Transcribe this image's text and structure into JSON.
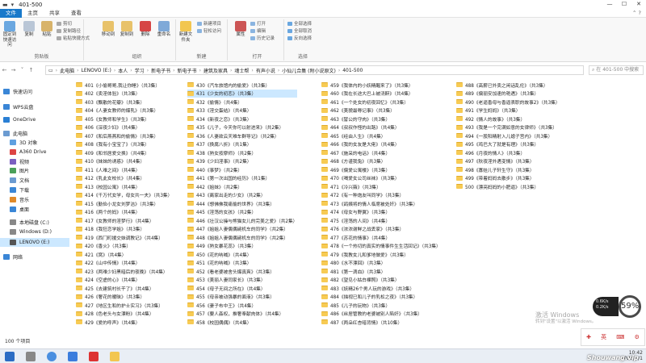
{
  "window": {
    "title": "401-500"
  },
  "ribbon_tabs": [
    "文件",
    "主页",
    "共享",
    "查看"
  ],
  "ribbon": {
    "groups": [
      {
        "label": "剪贴板",
        "big": [
          "固定到快速访问",
          "复制",
          "粘贴"
        ],
        "small": [
          "剪切",
          "复制路径",
          "粘贴快捷方式"
        ]
      },
      {
        "label": "组织",
        "big": [
          "移动到",
          "复制到",
          "删除",
          "重命名"
        ],
        "small": []
      },
      {
        "label": "新建",
        "big": [
          "新建文件夹"
        ],
        "small": [
          "新建项目",
          "轻松访问"
        ]
      },
      {
        "label": "打开",
        "big": [
          "属性"
        ],
        "small": [
          "打开",
          "编辑",
          "历史记录"
        ]
      },
      {
        "label": "选择",
        "big": [],
        "small": [
          "全部选择",
          "全部取消",
          "反向选择"
        ]
      }
    ]
  },
  "address": {
    "path": [
      "此电脑",
      "LENOVO (E:)",
      "本人",
      "学习",
      "新电子书",
      "新电子书",
      "建筑及家具",
      "魂士帮",
      "有声小说",
      "小仙儿合集 (附小说原文)",
      "401-500"
    ],
    "search_placeholder": "在 401-500 中搜索"
  },
  "nav": [
    {
      "label": "快速访问"
    },
    {
      "label": "WPS云盘"
    },
    {
      "label": "OneDrive"
    },
    {
      "label": "此电脑"
    },
    {
      "label": "3D 对象"
    },
    {
      "label": "A360 Drive"
    },
    {
      "label": "视频"
    },
    {
      "label": "图片"
    },
    {
      "label": "文档"
    },
    {
      "label": "下载"
    },
    {
      "label": "音乐"
    },
    {
      "label": "桌面"
    },
    {
      "label": "本地磁盘 (C:)"
    },
    {
      "label": "Windows (D:)"
    },
    {
      "label": "LENOVO (E:)"
    },
    {
      "label": "网络"
    }
  ],
  "files": [
    [
      "401《小偷哥哥,我让你睡》（共3集）",
      "402《卖淫体验》（共3集）",
      "403《飘散的花瓣》（共3集）",
      "404《人妻女教师的爆乳》（共3集）",
      "405《女教师和学生》（共3集）",
      "406《深夜少妇》（共4集）",
      "407《和后燕燕和的偷情》（共3集）",
      "408《我有小宝宝了》（共3集）",
      "409《和邻居爱交换》（共4集）",
      "410《妹妹的诱惑》（共4集）",
      "411《人难之间》（共4集）",
      "412《乳此女校长》（共4集）",
      "413《校园公寓》（共4集）",
      "414《千万代女学，母女共一夫》（共3集）",
      "415《勤俭小龙女刘梦洁》（共3集）",
      "416《两个的妈》（共4集）",
      "417《女教师的淫梦行》（共4集）",
      "418《我狂恋学姐》（共3集）",
      "419《西门町援交妹调教记》（共4集）",
      "420《香火》（共3集）",
      "421《窝》（共4集）",
      "422《山中传情》（共4集）",
      "423《两难少妇黑暗后的夜晚》（共4集）",
      "424《空虚的心》（共4集）",
      "425《去建筑村长干了》（共4集）",
      "426《奢花的暧昧》（共3集）",
      "427《地区生和的护士实习》（共3集）",
      "428《色老头与女漂粉》（共4集）",
      "429《爱的呼声》（共4集）"
    ],
    [
      "430《汽车旅馆内的偷爱》（共3集）",
      "431《少女的初恋》（共3集）",
      "432《偷情》（共4集）",
      "433《淫交蛋结》（共4集）",
      "434《新夜之恋》（共3集）",
      "435《儿子，今天你可以射进来》（共2集）",
      "436《人妻欲云天难车群导记》（共2集）",
      "437《换腐八折》（共1集）",
      "438《熟女按摩师》（共2集）",
      "439《少妇淫事》（共2集）",
      "440《事梦》（共2集）",
      "441《第一次出国的经历》（共1集）",
      "442《姐妹》（共2集）",
      "443《离家出走的少女》（共2集）",
      "444《想佛佛我痛偷的世界》（共3集）",
      "445《淫荡的女孩》（共2集）",
      "446《壮汉公操与熊猫女儿的完美之爱》（共2集）",
      "447《姐姐人妻偶偶碗机车的同学》（共2集）",
      "448《姐姐人妻偶偶碗机车的同学》（共2集）",
      "449《熟女暴花蕊》（共3集）",
      "450《花的呐喊》（共4集）",
      "451《花的呐喊》（共3集）",
      "452《看老婆被舍头爆真爽》（共3集）",
      "453《美丽人妻同家长》（共3集）",
      "454《母子无间之所在》（共4集）",
      "455《母亲被动强暴的面液》（共3集）",
      "456《妻子布中王》（共4集）",
      "457《要人姦权，推奢奉献肉体》（共4集）",
      "458《校园偶偶》（共4集）"
    ],
    [
      "459《我体内的小妖精醒来了》（共3集）",
      "460《我在长途大巴上被浇醉》（共4集）",
      "461《一个处女的初夜回忆》（共3集）",
      "462《美貌最辱记事》（共3集）",
      "463《譬公的守肉》（共3集）",
      "464《叔叔作怪的出路》（共4集）",
      "465《经由人生》（共4集）",
      "466《我的女友是大佬》（共4集）",
      "467《施采的电话》（共4集）",
      "468《方谨我兔》（共3集）",
      "469《偏爱公寓楼》（共3集）",
      "470《喝爱女公司丝袜》（共3集）",
      "471《冷兴薇》（共3集）",
      "472《有一种炮友叫同学》（共3集）",
      "473《鸽姨将的情人临席被处奸》（共3集）",
      "474《母女与野翼》（共3集）",
      "475《淫荡的人间》（共4集）",
      "476《浓浓谢鲜之战丢家》（共3集）",
      "477《苏花的情事》（共4集）",
      "478《一个热切的真实的情事件生生活回记》（共3集）",
      "479《我教女儿和爹地做爱》（共3集）",
      "480《水不漂回》（共3集）",
      "481《第一滴血》（共3集）",
      "482《望见小姑白裸照》（共3集）",
      "483《妖精26个男人玩的游戏》（共3集）",
      "484《描视已和儿子的乳松之夜》（共3集）",
      "485《儿子的玩物》（共3集）",
      "486《丝居管教的老婆被别人陷奸》（共3集）",
      "487《两朵红杏暗背情》（共10集）"
    ],
    [
      "488《高薪已外卖之闲话乱伦》（共3集）",
      "489《偏丽安加速的艳遇》（共3集）",
      "490《老逼香母与香逼表职的故事2》（共3集）",
      "491《学生妈妈》（共3集）",
      "492《情人的故事》（共3集）",
      "493《我是一个完满如意的女律师》（共3集）",
      "494《一股阳精射入儿媳子宫内》（共3集）",
      "495《鸡巴大了就是有理》（共3集）",
      "496《月夜的情人》（共3集）",
      "497《秋夜淫外遇变情》（共3集）",
      "498《寡娃儿子轩生守》（共3集）",
      "499《带着妈妈去散步》（共3集）",
      "500《漂亮妈妈的小肥逼》（共3集）"
    ]
  ],
  "status": {
    "count": "100 个项目"
  },
  "tray": {
    "time": "10:42",
    "date": "2023/9/1",
    "lang": "英",
    "gauge": "59%",
    "speed_up": "0.6K/s",
    "speed_down": "0.2K/s"
  },
  "watermark": {
    "line1": "激活 Windows",
    "line2": "转到\"设置\"以激活 Windows。"
  },
  "logo": "Shouwang.vip",
  "colors": {
    "accent": "#1979ca",
    "selected": "#cce8ff",
    "folder": "#f7cb54"
  }
}
